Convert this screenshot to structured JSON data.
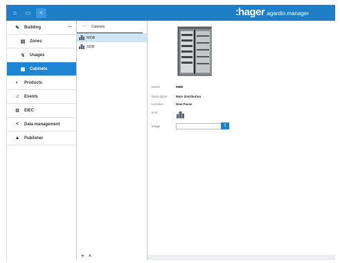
{
  "header": {
    "buttons": [
      {
        "name": "home",
        "glyph": "⌂"
      },
      {
        "name": "screen",
        "glyph": "▭"
      },
      {
        "name": "share",
        "glyph": "<"
      }
    ],
    "brand_colon": ":",
    "brand_name": "hager",
    "brand_sub": ".agardio.manager"
  },
  "nav": {
    "items": [
      {
        "label": "Building",
        "icon": "✎",
        "caret": "—"
      },
      {
        "label": "Zones",
        "icon": "▤"
      },
      {
        "label": "Usages",
        "icon": "↯"
      },
      {
        "label": "Cabinets",
        "icon": "▦"
      },
      {
        "label": "Products",
        "icon": "◐"
      },
      {
        "label": "Events",
        "icon": "♫"
      },
      {
        "label": "EIEC",
        "icon": "⚙"
      },
      {
        "label": "Data management",
        "icon": "<"
      },
      {
        "label": "Publisher",
        "icon": "▲"
      }
    ]
  },
  "tree": {
    "header_label": "Cabinets",
    "header_chevron": "⌵",
    "rows": [
      "MDB",
      "SDB"
    ],
    "add_label": "+",
    "remove_label": "×"
  },
  "detail": {
    "name_label": "Name",
    "name_value": "MDB",
    "description_label": "Description",
    "description_value": "Main distribution",
    "location_label": "Location",
    "location_value": "New Passe",
    "icon_label": "Icon",
    "image_label": "Image",
    "upload_glyph": "⇪"
  },
  "colors": {
    "accent": "#1e7ec8",
    "active_nav": "#1f84d1",
    "selected_row": "#cfe4f5"
  }
}
